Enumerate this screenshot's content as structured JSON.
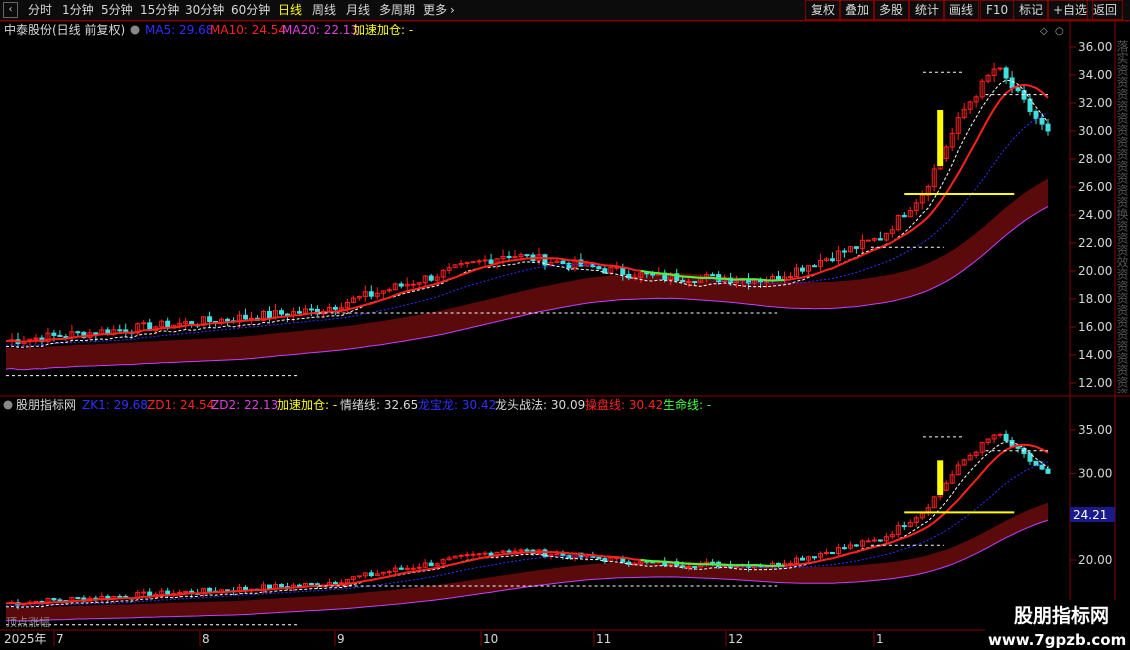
{
  "toolbar": {
    "tabs": [
      "分时",
      "1分钟",
      "5分钟",
      "15分钟",
      "30分钟",
      "60分钟",
      "日线",
      "周线",
      "月线",
      "多周期",
      "更多"
    ],
    "active_tab": "日线",
    "tools": [
      "复权",
      "叠加",
      "多股",
      "统计",
      "画线",
      "F10",
      "标记",
      "+自选",
      "返回"
    ]
  },
  "price_panel": {
    "title": "中泰股份(日线 前复权)",
    "ma5_label": "MA5: 29.68",
    "ma10_label": "MA10: 24.54",
    "ma20_label": "MA20: 22.13",
    "accel_label": "加速加仓: -",
    "y_ticks": [
      "36.00",
      "34.00",
      "32.00",
      "30.00",
      "28.00",
      "26.00",
      "24.00",
      "22.00",
      "20.00",
      "18.00",
      "16.00",
      "14.00",
      "12.00"
    ],
    "y_values": [
      36,
      34,
      32,
      30,
      28,
      26,
      24,
      22,
      20,
      18,
      16,
      14,
      12
    ],
    "side_text": "落实资资资资资资资资资资资资换资资资效资资资资资资资资资资资资资资"
  },
  "indicator_panel": {
    "title": "股朋指标网",
    "zk1_label": "ZK1: 29.68",
    "zd1_label": "ZD1: 24.54",
    "zd2_label": "ZD2: 22.13",
    "accel_label": "加速加仓: -",
    "mood_label": "情绪线: 32.65",
    "dragon_label": "龙宝龙: 30.42",
    "leader_label": "龙头战法: 30.09",
    "control_label": "操盘线: 30.42",
    "life_label": "生命线: -",
    "y_ticks": [
      "35.00",
      "30.00",
      "25.00",
      "20.00"
    ],
    "y_values": [
      35,
      30,
      25,
      20
    ],
    "current_price_label": "24.21",
    "bottom_left_text": "顶点涨幅"
  },
  "date_axis": {
    "labels": [
      "2025年",
      "7",
      "8",
      "9",
      "10",
      "11",
      "12",
      "1"
    ]
  },
  "watermark": {
    "name": "股朋指标网",
    "url": "www.7gpzb.com"
  },
  "colors": {
    "ma5": "#ffffff",
    "ma10": "#ff2020",
    "ma20": "#3030ff",
    "candle_up": "#ff2020",
    "candle_down": "#40e0e0",
    "accent_yellow": "#ffff00",
    "ribbon": "#5a0a0a",
    "life_line": "#c040ff",
    "grid_border": "#8b0000"
  }
}
